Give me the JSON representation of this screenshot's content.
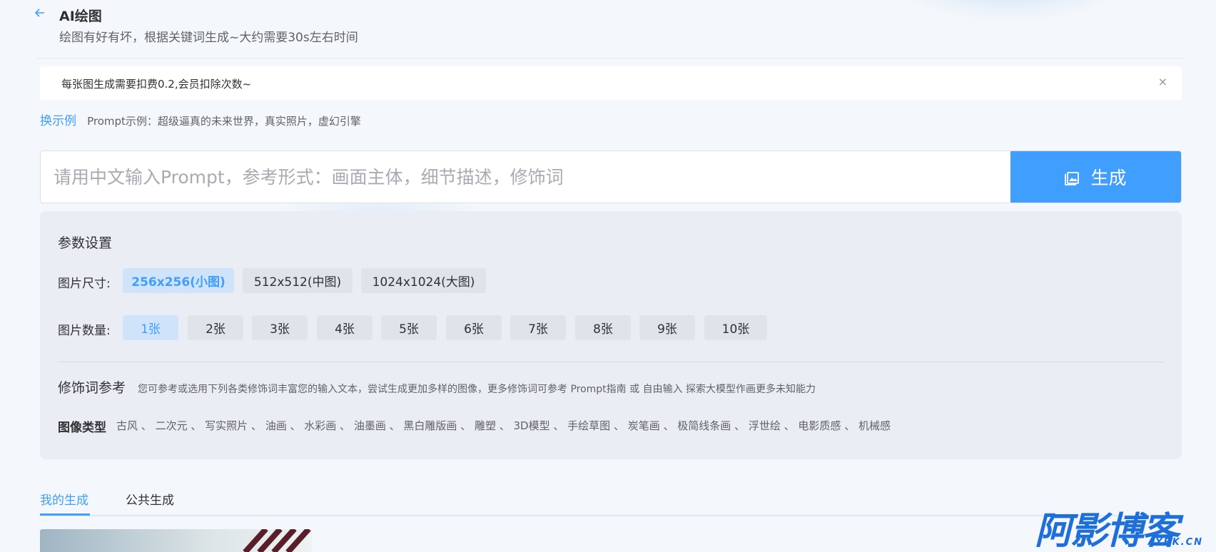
{
  "header": {
    "back_icon": "arrow-left-icon",
    "title": "AI绘图",
    "subtitle": "绘图有好有坏，根据关键词生成~大约需要30s左右时间"
  },
  "notice": {
    "text": "每张图生成需要扣费0.2,会员扣除次数~",
    "close_symbol": "×"
  },
  "example": {
    "switch_label": "换示例",
    "text": "Prompt示例：超级逼真的未来世界，真实照片，虚幻引擎"
  },
  "prompt": {
    "placeholder": "请用中文输入Prompt，参考形式：画面主体，细节描述，修饰词",
    "generate_label": "生成",
    "generate_icon": "image-icon"
  },
  "params": {
    "title": "参数设置",
    "size_label": "图片尺寸:",
    "sizes": [
      "256x256(小图)",
      "512x512(中图)",
      "1024x1024(大图)"
    ],
    "size_selected": "256x256(小图)",
    "count_label": "图片数量:",
    "counts": [
      "1张",
      "2张",
      "3张",
      "4张",
      "5张",
      "6张",
      "7张",
      "8张",
      "9张",
      "10张"
    ],
    "count_selected": "1张",
    "modifier_title": "修饰词参考",
    "modifier_desc": "您可参考或选用下列各类修饰词丰富您的输入文本，尝试生成更加多样的图像，更多修饰词可参考 Prompt指南 或 自由输入 探索大模型作画更多未知能力",
    "type_label": "图像类型",
    "types": [
      "古风",
      "二次元",
      "写实照片",
      "油画",
      "水彩画",
      "油墨画",
      "黑白雕版画",
      "雕塑",
      "3D模型",
      "手绘草图",
      "炭笔画",
      "极简线条画",
      "浮世绘",
      "电影质感",
      "机械感"
    ],
    "type_separator": " 、"
  },
  "tabs": {
    "mine": "我的生成",
    "public": "公共生成"
  },
  "watermark": {
    "main": "阿影博客",
    "sub": "AYBK.CN"
  },
  "colors": {
    "accent": "#409eff",
    "background": "#f4f7fb",
    "panel": "#eaeef4",
    "logo": "#1e6fd9"
  }
}
